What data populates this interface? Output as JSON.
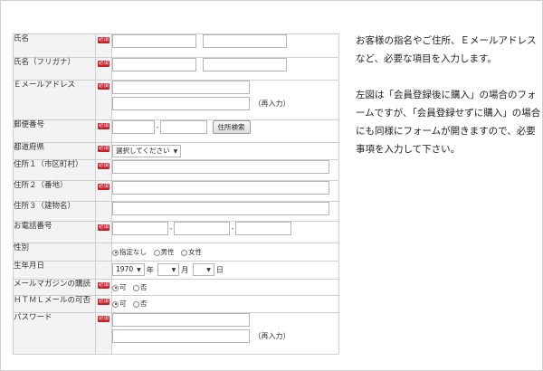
{
  "required_badge": "必須",
  "rows": [
    {
      "label": "氏名"
    },
    {
      "label": "氏名（フリガナ）"
    },
    {
      "label": "Ｅメールアドレス",
      "reenter": "（再入力）"
    },
    {
      "label": "郵便番号",
      "button": "住所検索"
    },
    {
      "label": "都道府県",
      "select": "選択してください"
    },
    {
      "label": "住所１（市区町村）"
    },
    {
      "label": "住所２（番地）"
    },
    {
      "label": "住所３（建物名）"
    },
    {
      "label": "お電話番号"
    },
    {
      "label": "性別",
      "options": [
        "指定なし",
        "男性",
        "女性"
      ]
    },
    {
      "label": "生年月日",
      "year": "1970",
      "year_unit": "年",
      "month_unit": "月",
      "day_unit": "日"
    },
    {
      "label": "メールマガジンの購読",
      "options": [
        "可",
        "否"
      ]
    },
    {
      "label": "ＨＴＭＬメールの可否",
      "options": [
        "可",
        "否"
      ]
    },
    {
      "label": "パスワード",
      "reenter": "（再入力）"
    }
  ],
  "description": {
    "para1": "お客様の指名やご住所、Ｅメールアドレスなど、必要な項目を入力します。",
    "para2": "左図は「会員登録後に購入」の場合のフォームですが、「会員登録せずに購入」の場合にも同様にフォームが開きますので、必要事項を入力して下さい。"
  }
}
